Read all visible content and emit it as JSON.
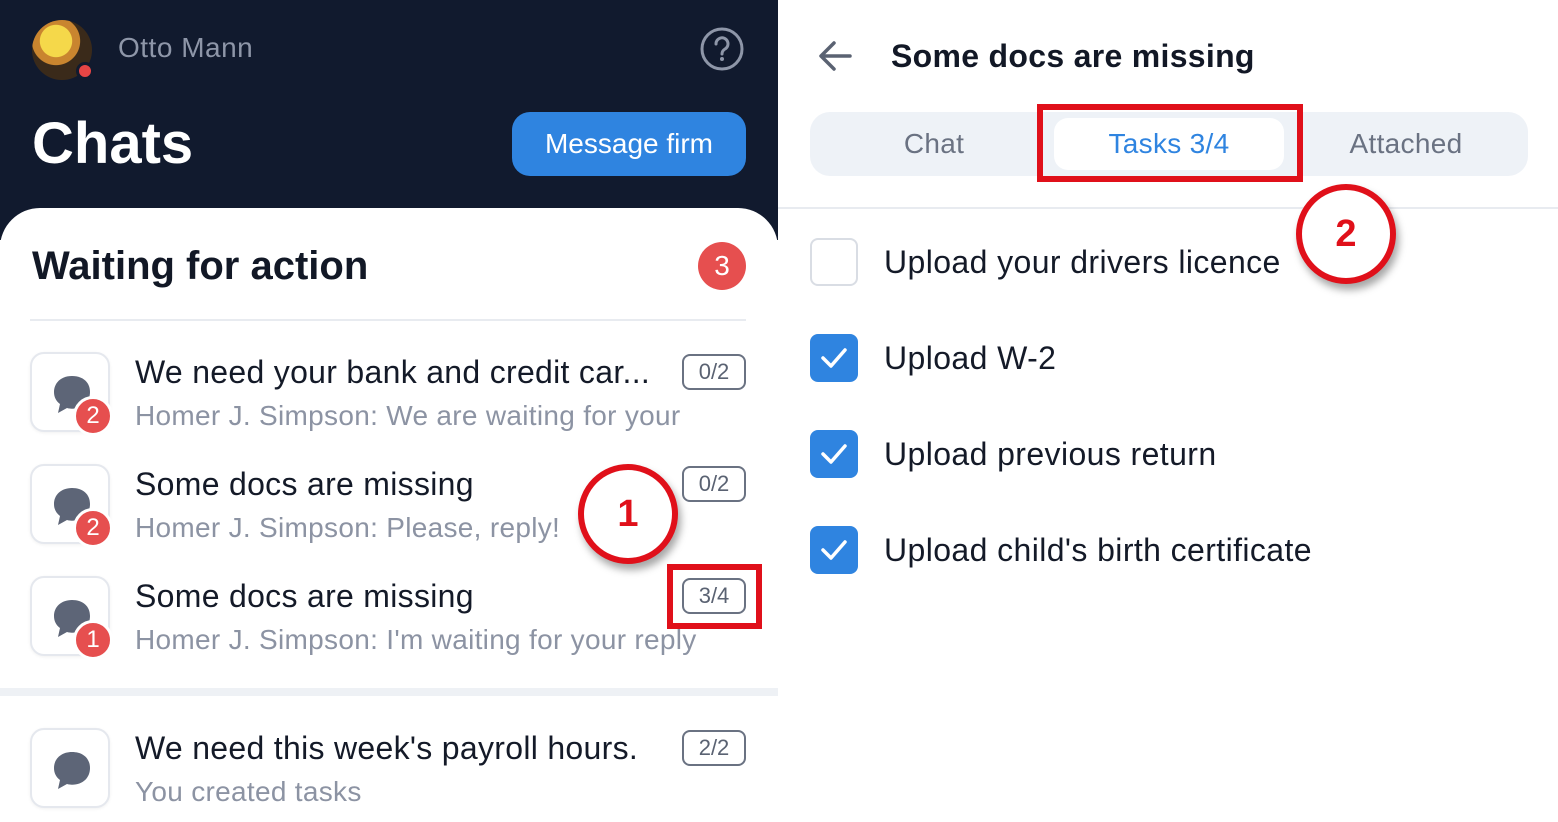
{
  "left": {
    "user_name": "Otto Mann",
    "title": "Chats",
    "message_button": "Message firm",
    "section_title": "Waiting for action",
    "section_count": "3",
    "chats": [
      {
        "title": "We need your bank and credit car...",
        "subtitle": "Homer J. Simpson: We are waiting for your",
        "badge": "2",
        "progress": "0/2"
      },
      {
        "title": "Some docs are missing",
        "subtitle": "Homer J. Simpson: Please, reply!",
        "badge": "2",
        "progress": "0/2"
      },
      {
        "title": "Some docs are missing",
        "subtitle": "Homer J. Simpson: I'm waiting for your reply",
        "badge": "1",
        "progress": "3/4"
      },
      {
        "title": "We need this week's payroll hours.",
        "subtitle": "You created tasks",
        "badge": "",
        "progress": "2/2"
      }
    ]
  },
  "right": {
    "title": "Some docs are missing",
    "tabs": [
      {
        "label": "Chat",
        "active": false
      },
      {
        "label": "Tasks 3/4",
        "active": true
      },
      {
        "label": "Attached",
        "active": false
      }
    ],
    "tasks": [
      {
        "label": "Upload your drivers licence",
        "checked": false
      },
      {
        "label": "Upload W-2",
        "checked": true
      },
      {
        "label": "Upload previous return",
        "checked": true
      },
      {
        "label": "Upload child's birth certificate",
        "checked": true
      }
    ]
  },
  "annotations": {
    "callout_1": "1",
    "callout_2": "2"
  },
  "colors": {
    "header_bg": "#111a2e",
    "accent": "#2f84e0",
    "badge_red": "#e64f4f",
    "annotation_red": "#e0101a"
  },
  "icons": {
    "help": "help-circle-icon",
    "back": "arrow-left-icon",
    "chat": "chat-bubble-icon",
    "check": "checkmark-icon"
  }
}
